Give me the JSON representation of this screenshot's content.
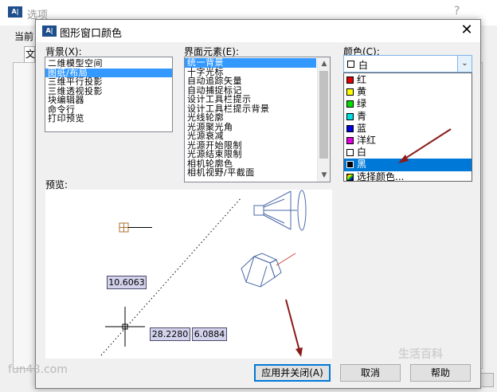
{
  "background_window": {
    "title": "选项",
    "help": "?",
    "current_label": "当前",
    "tab_label": "文"
  },
  "dialog": {
    "title": "图形窗口颜色",
    "close": "✕",
    "context_label": "背景(X):",
    "contexts": [
      "二维模型空间",
      "图纸/布局",
      "三维平行投影",
      "三维透视投影",
      "块编辑器",
      "命令行",
      "打印预览"
    ],
    "selected_context_index": 1,
    "element_label": "界面元素(E):",
    "elements": [
      "统一背景",
      "十字光标",
      "自动追踪矢量",
      "自动捕捉标记",
      "设计工具栏提示",
      "设计工具栏提示背景",
      "光线轮廓",
      "光源聚光角",
      "光源衰减",
      "光源开始限制",
      "光源结束限制",
      "相机轮廓色",
      "相机视野/平截面"
    ],
    "selected_element_index": 0,
    "color_label": "颜色(C):",
    "color_selected": "白",
    "color_options": [
      {
        "label": "红",
        "color": "#e00000"
      },
      {
        "label": "黄",
        "color": "#ffff00"
      },
      {
        "label": "绿",
        "color": "#00e000"
      },
      {
        "label": "青",
        "color": "#00e0e0"
      },
      {
        "label": "蓝",
        "color": "#0000e0"
      },
      {
        "label": "洋红",
        "color": "#e000e0"
      },
      {
        "label": "白",
        "color": "#ffffff"
      },
      {
        "label": "黑",
        "color": "#000000"
      },
      {
        "label": "选择颜色...",
        "color": "multi"
      }
    ],
    "highlighted_color_index": 7,
    "preview_label": "预览:",
    "preview_values": [
      "10.6063",
      "28.2280",
      "6.0884"
    ],
    "buttons": {
      "apply_close": "应用并关闭(A)",
      "cancel": "取消",
      "help": "帮助"
    }
  },
  "watermarks": [
    "fun48.com",
    "生活百科"
  ],
  "colors": {
    "selection": "#3399ff",
    "highlight": "#0078d7",
    "annotation_arrow": "#8b1a1a"
  }
}
